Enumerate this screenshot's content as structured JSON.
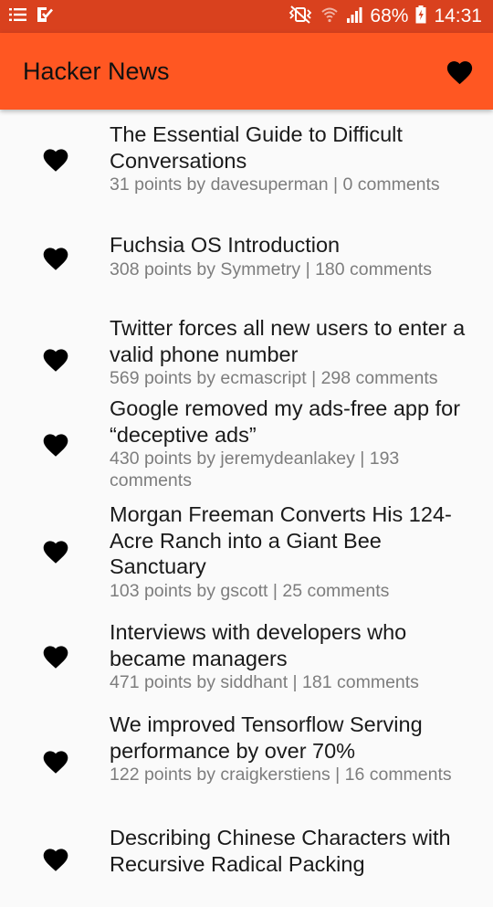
{
  "status_bar": {
    "battery": "68%",
    "time": "14:31",
    "left_icons": [
      "list-notification-icon",
      "checklist-notification-icon"
    ],
    "right_icons": [
      "vibrate-icon",
      "wifi-icon",
      "signal-icon",
      "battery-charging-icon"
    ]
  },
  "app_bar": {
    "title": "Hacker News",
    "action_icon": "heart-icon",
    "color": "#ff5722"
  },
  "stories": [
    {
      "title": "The Essential Guide to Difficult Conversations",
      "meta": "31 points by davesuperman | 0 comments"
    },
    {
      "title": "Fuchsia OS Introduction",
      "meta": "308 points by Symmetry | 180 comments"
    },
    {
      "title": "Twitter forces all new users to enter a valid phone number",
      "meta": "569 points by ecmascript | 298 comments"
    },
    {
      "title": "Google removed my ads-free app for “deceptive ads”",
      "meta": "430 points by jeremydeanlakey | 193 comments"
    },
    {
      "title": "Morgan Freeman Converts His 124-Acre Ranch into a Giant Bee Sanctuary",
      "meta": "103 points by gscott | 25 comments"
    },
    {
      "title": "Interviews with developers who became managers",
      "meta": "471 points by siddhant | 181 comments"
    },
    {
      "title": "We improved Tensorflow Serving performance by over 70%",
      "meta": "122 points by craigkerstiens | 16 comments"
    },
    {
      "title": "Describing Chinese Characters with Recursive Radical Packing",
      "meta": ""
    }
  ]
}
